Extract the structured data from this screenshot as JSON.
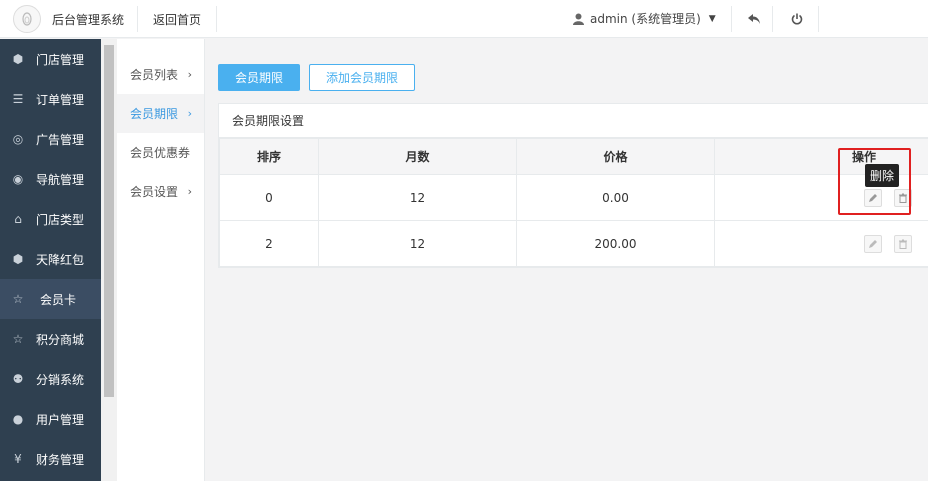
{
  "header": {
    "brand": "后台管理系统",
    "home_link": "返回首页",
    "user": "admin (系统管理员)"
  },
  "sidebar": {
    "items": [
      {
        "label": "门店管理",
        "icon": "cubes-icon"
      },
      {
        "label": "订单管理",
        "icon": "list-icon"
      },
      {
        "label": "广告管理",
        "icon": "lifebuoy-icon"
      },
      {
        "label": "导航管理",
        "icon": "compass-icon"
      },
      {
        "label": "门店类型",
        "icon": "bank-icon"
      },
      {
        "label": "天降红包",
        "icon": "cubes-icon"
      },
      {
        "label": "会员卡",
        "icon": "star-icon",
        "active": true
      },
      {
        "label": "积分商城",
        "icon": "star-icon"
      },
      {
        "label": "分销系统",
        "icon": "users-icon"
      },
      {
        "label": "用户管理",
        "icon": "user-icon"
      },
      {
        "label": "财务管理",
        "icon": "yen-icon"
      }
    ]
  },
  "submenu": {
    "items": [
      {
        "label": "会员列表",
        "chevron": "›"
      },
      {
        "label": "会员期限",
        "chevron": "›",
        "active": true
      },
      {
        "label": "会员优惠券",
        "chevron": ""
      },
      {
        "label": "会员设置",
        "chevron": "›"
      }
    ]
  },
  "toolbar": {
    "active_button": "会员期限",
    "add_button": "添加会员期限"
  },
  "panel": {
    "title": "会员期限设置",
    "columns": [
      "排序",
      "月数",
      "价格",
      "操作"
    ],
    "rows": [
      {
        "sort": "0",
        "months": "12",
        "price": "0.00"
      },
      {
        "sort": "2",
        "months": "12",
        "price": "200.00"
      }
    ]
  },
  "tooltip": "删除",
  "colors": {
    "accent": "#4ab0ef",
    "sidebar_bg": "#2f4050",
    "highlight": "#e02020"
  }
}
